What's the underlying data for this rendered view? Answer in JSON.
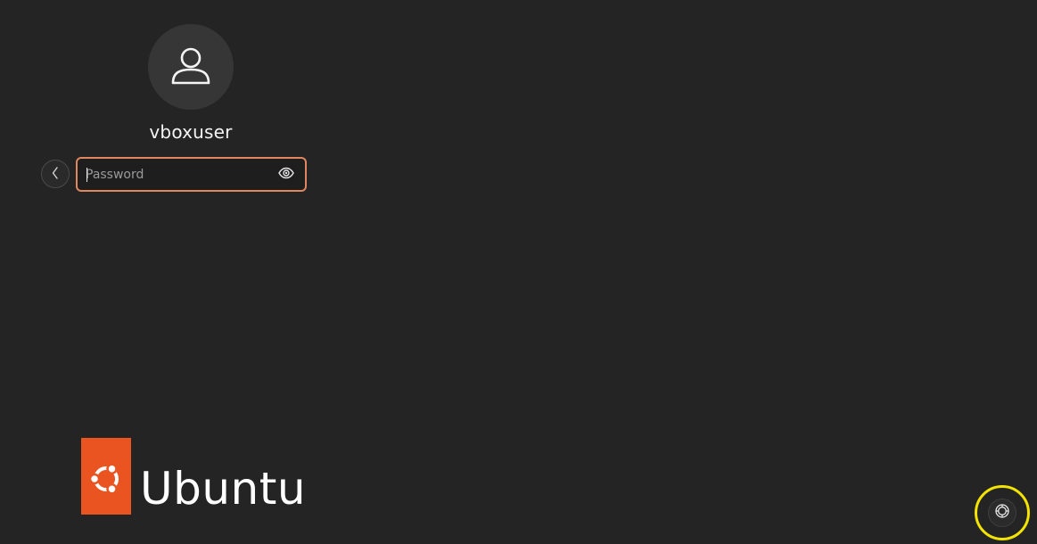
{
  "user": {
    "name": "vboxuser"
  },
  "password": {
    "placeholder": "Password",
    "value": ""
  },
  "branding": {
    "text": "Ubuntu",
    "color": "#e95420"
  },
  "icons": {
    "avatar": "user-icon",
    "back": "chevron-left-icon",
    "reveal": "eye-icon",
    "accessibility": "accessibility-icon"
  },
  "colors": {
    "background": "#242424",
    "field_focus_border": "#e0875f",
    "highlight_ring": "#f2e300"
  }
}
